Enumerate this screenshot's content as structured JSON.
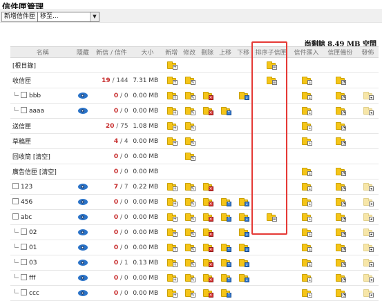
{
  "page_title": "信件匣管理",
  "toolbar": {
    "new_folder": "新增信件匣",
    "move_select": "移至..."
  },
  "space_info": "尚剩餘 8.49 MB 空間",
  "columns": [
    "名稱",
    "隱藏",
    "新信 / 信件",
    "大小",
    "新增",
    "修改",
    "刪除",
    "上移",
    "下移",
    "排序子信匣",
    "信件匯入",
    "信匣備份",
    "發佈"
  ],
  "rows": [
    {
      "name": "[根目錄]",
      "sub": false,
      "cb": false,
      "eye": false,
      "new": "",
      "total": "",
      "size": "",
      "add": true,
      "edit": false,
      "del": false,
      "up": false,
      "down": false,
      "sort": true,
      "imp": false,
      "bak": false,
      "pub": false
    },
    {
      "name": "收信匣",
      "sub": false,
      "cb": false,
      "eye": false,
      "new": "19",
      "total": "144",
      "size": "7.31 MB",
      "add": true,
      "edit": true,
      "del": false,
      "up": false,
      "down": false,
      "sort": true,
      "imp": true,
      "bak": true,
      "pub": false
    },
    {
      "name": "bbb",
      "sub": true,
      "cb": true,
      "eye": true,
      "new": "0",
      "total": "0",
      "size": "0.00 MB",
      "add": true,
      "edit": true,
      "del": true,
      "up": false,
      "down": true,
      "sort": false,
      "imp": true,
      "bak": true,
      "pub": true
    },
    {
      "name": "aaaa",
      "sub": true,
      "cb": true,
      "eye": true,
      "new": "0",
      "total": "0",
      "size": "0.00 MB",
      "add": true,
      "edit": true,
      "del": true,
      "up": true,
      "down": false,
      "sort": false,
      "imp": true,
      "bak": true,
      "pub": true
    },
    {
      "name": "送信匣",
      "sub": false,
      "cb": false,
      "eye": false,
      "new": "20",
      "total": "75",
      "size": "1.08 MB",
      "add": true,
      "edit": true,
      "del": false,
      "up": false,
      "down": false,
      "sort": false,
      "imp": true,
      "bak": true,
      "pub": false
    },
    {
      "name": "草稿匣",
      "sub": false,
      "cb": false,
      "eye": false,
      "new": "4",
      "total": "4",
      "size": "0.00 MB",
      "add": true,
      "edit": true,
      "del": false,
      "up": false,
      "down": false,
      "sort": false,
      "imp": true,
      "bak": true,
      "pub": false
    },
    {
      "name": "回收筒 [清空]",
      "sub": false,
      "cb": false,
      "eye": false,
      "new": "0",
      "total": "0",
      "size": "0.00 MB",
      "add": false,
      "edit": true,
      "del": false,
      "up": false,
      "down": false,
      "sort": false,
      "imp": false,
      "bak": false,
      "pub": false
    },
    {
      "name": "廣告信匣 [清空]",
      "sub": false,
      "cb": false,
      "eye": false,
      "new": "0",
      "total": "0",
      "size": "0.00 MB",
      "add": false,
      "edit": false,
      "del": false,
      "up": false,
      "down": false,
      "sort": false,
      "imp": true,
      "bak": true,
      "pub": false
    },
    {
      "name": "123",
      "sub": false,
      "cb": true,
      "eye": true,
      "new": "7",
      "total": "7",
      "size": "0.22 MB",
      "add": true,
      "edit": true,
      "del": true,
      "up": false,
      "down": false,
      "sort": false,
      "imp": true,
      "bak": true,
      "pub": true
    },
    {
      "name": "456",
      "sub": false,
      "cb": true,
      "eye": true,
      "new": "0",
      "total": "0",
      "size": "0.00 MB",
      "add": true,
      "edit": true,
      "del": true,
      "up": true,
      "down": true,
      "sort": false,
      "imp": true,
      "bak": true,
      "pub": true
    },
    {
      "name": "abc",
      "sub": false,
      "cb": true,
      "eye": true,
      "new": "0",
      "total": "0",
      "size": "0.00 MB",
      "add": true,
      "edit": true,
      "del": true,
      "up": true,
      "down": true,
      "sort": true,
      "imp": true,
      "bak": true,
      "pub": true
    },
    {
      "name": "02",
      "sub": true,
      "cb": true,
      "eye": true,
      "new": "0",
      "total": "0",
      "size": "0.00 MB",
      "add": true,
      "edit": true,
      "del": true,
      "up": false,
      "down": true,
      "sort": false,
      "imp": true,
      "bak": true,
      "pub": true
    },
    {
      "name": "01",
      "sub": true,
      "cb": true,
      "eye": true,
      "new": "0",
      "total": "0",
      "size": "0.00 MB",
      "add": true,
      "edit": true,
      "del": true,
      "up": true,
      "down": true,
      "sort": false,
      "imp": true,
      "bak": true,
      "pub": true
    },
    {
      "name": "03",
      "sub": true,
      "cb": true,
      "eye": true,
      "new": "0",
      "total": "1",
      "size": "0.13 MB",
      "add": true,
      "edit": true,
      "del": true,
      "up": true,
      "down": true,
      "sort": false,
      "imp": true,
      "bak": true,
      "pub": true
    },
    {
      "name": "fff",
      "sub": true,
      "cb": true,
      "eye": true,
      "new": "0",
      "total": "0",
      "size": "0.00 MB",
      "add": true,
      "edit": true,
      "del": true,
      "up": true,
      "down": true,
      "sort": false,
      "imp": true,
      "bak": true,
      "pub": true
    },
    {
      "name": "ccc",
      "sub": true,
      "cb": true,
      "eye": true,
      "new": "0",
      "total": "0",
      "size": "0.00 MB",
      "add": true,
      "edit": true,
      "del": true,
      "up": true,
      "down": false,
      "sort": false,
      "imp": true,
      "bak": true,
      "pub": true
    }
  ],
  "colors": {
    "count_red": "#c62828",
    "folder": "#f5c518",
    "highlight": "#e53935",
    "eye": "#2a73c8"
  },
  "icons": {
    "add": "folder-add-icon",
    "edit": "folder-edit-icon",
    "del": "folder-delete-icon",
    "up": "folder-up-icon",
    "down": "folder-down-icon",
    "sort": "folder-sort-icon",
    "imp": "folder-import-icon",
    "bak": "folder-backup-icon",
    "pub": "folder-publish-icon"
  }
}
